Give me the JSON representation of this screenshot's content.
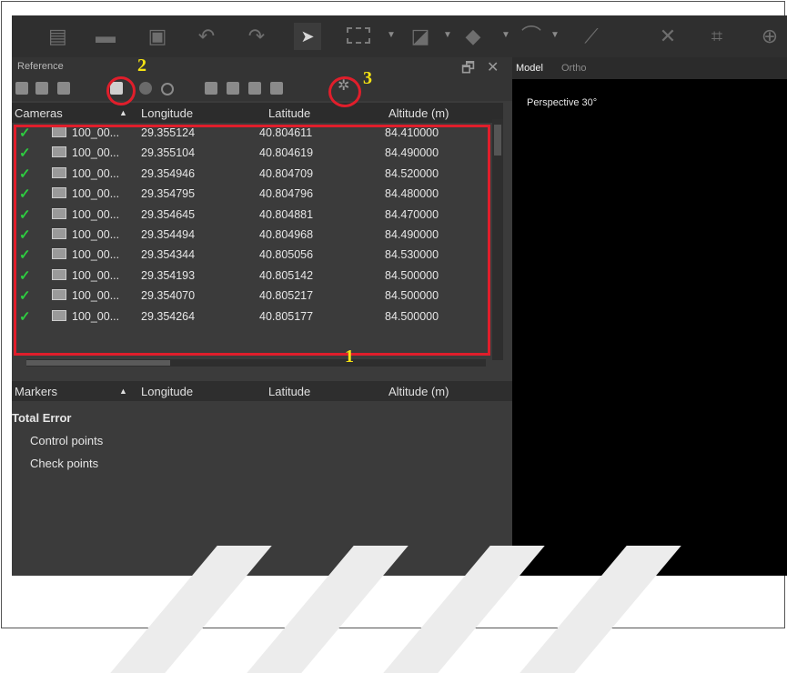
{
  "toolbar": {
    "icons": [
      "new-icon",
      "open-icon",
      "save-icon",
      "undo-icon",
      "redo-icon",
      "navigate-icon",
      "rectangle-selection-icon",
      "rotate-object-icon",
      "resize-region-icon",
      "ruler-icon",
      "delete-icon",
      "crop-icon",
      "zoom-in-icon"
    ]
  },
  "reference_panel": {
    "title": "Reference",
    "cameras_header": {
      "name": "Cameras",
      "sort": "▲",
      "longitude": "Longitude",
      "latitude": "Latitude",
      "altitude": "Altitude (m)"
    },
    "cameras": [
      {
        "name": "100_00...",
        "longitude": "29.355124",
        "latitude": "40.804611",
        "altitude": "84.410000"
      },
      {
        "name": "100_00...",
        "longitude": "29.355104",
        "latitude": "40.804619",
        "altitude": "84.490000"
      },
      {
        "name": "100_00...",
        "longitude": "29.354946",
        "latitude": "40.804709",
        "altitude": "84.520000"
      },
      {
        "name": "100_00...",
        "longitude": "29.354795",
        "latitude": "40.804796",
        "altitude": "84.480000"
      },
      {
        "name": "100_00...",
        "longitude": "29.354645",
        "latitude": "40.804881",
        "altitude": "84.470000"
      },
      {
        "name": "100_00...",
        "longitude": "29.354494",
        "latitude": "40.804968",
        "altitude": "84.490000"
      },
      {
        "name": "100_00...",
        "longitude": "29.354344",
        "latitude": "40.805056",
        "altitude": "84.530000"
      },
      {
        "name": "100_00...",
        "longitude": "29.354193",
        "latitude": "40.805142",
        "altitude": "84.500000"
      },
      {
        "name": "100_00...",
        "longitude": "29.354070",
        "latitude": "40.805217",
        "altitude": "84.500000"
      },
      {
        "name": "100_00...",
        "longitude": "29.354264",
        "latitude": "40.805177",
        "altitude": "84.500000"
      }
    ],
    "markers_header": {
      "name": "Markers",
      "sort": "▲",
      "longitude": "Longitude",
      "latitude": "Latitude",
      "altitude": "Altitude (m)"
    },
    "total_error": "Total Error",
    "control_points": "Control points",
    "check_points": "Check points"
  },
  "viewport": {
    "tab_model": "Model",
    "tab_ortho": "Ortho",
    "label": "Perspective 30°"
  },
  "annotations": {
    "one": "1",
    "two": "2",
    "three": "3"
  }
}
